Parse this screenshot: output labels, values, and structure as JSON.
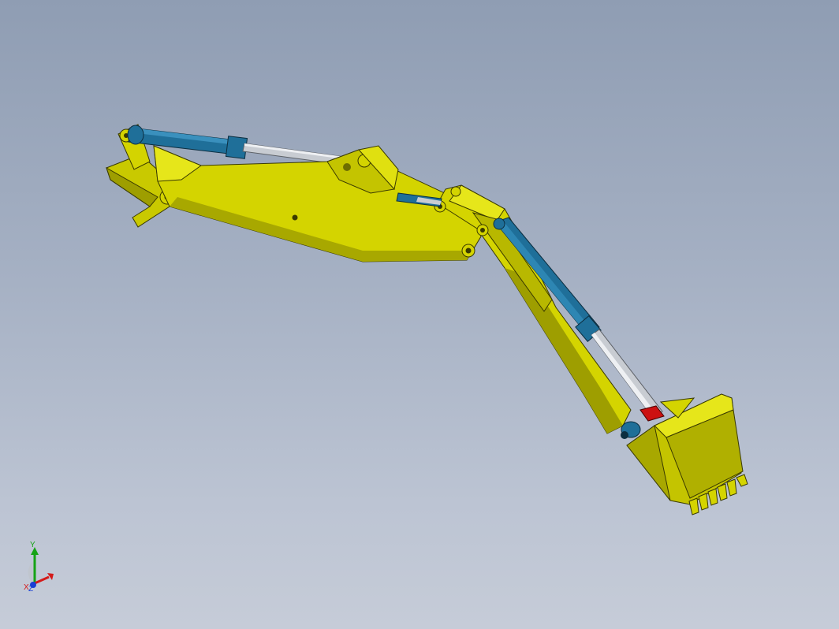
{
  "viewport": {
    "background_top": "#8f9db3",
    "background_bottom": "#c6ccd8"
  },
  "model": {
    "parts": [
      "boom",
      "arm",
      "bucket",
      "boom-cylinder",
      "arm-cylinder",
      "bucket-cylinder",
      "base-bracket"
    ],
    "colors": {
      "steel_yellow": "#d4d400",
      "steel_yellow_shade": "#9e9e00",
      "steel_yellow_dark": "#6e6e00",
      "cylinder_barrel": "#1f6f99",
      "cylinder_rod": "#c8ccd2",
      "linkage_red": "#cc1111"
    }
  },
  "triad": {
    "y_label": "Y",
    "x_label": "X",
    "z_label": "Z",
    "colors": {
      "x": "#d41a1a",
      "y": "#16a316",
      "z": "#1a3fd4"
    }
  }
}
